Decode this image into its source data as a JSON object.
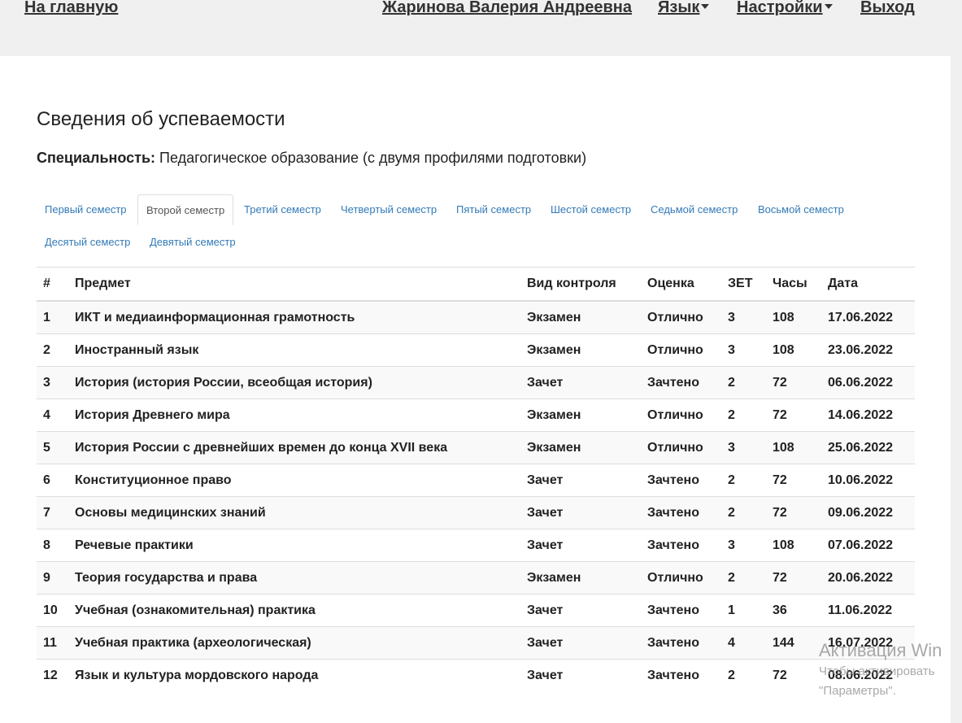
{
  "nav": {
    "home": "На главную",
    "user": "Жаринова Валерия Андреевна",
    "language": "Язык",
    "settings": "Настройки",
    "logout": "Выход"
  },
  "page": {
    "title": "Сведения об успеваемости",
    "specialty_label": "Специальность:",
    "specialty_value": " Педагогическое образование (с двумя профилями подготовки)"
  },
  "tabs": [
    {
      "label": "Первый семестр",
      "active": false
    },
    {
      "label": "Второй семестр",
      "active": true
    },
    {
      "label": "Третий семестр",
      "active": false
    },
    {
      "label": "Четвертый семестр",
      "active": false
    },
    {
      "label": "Пятый семестр",
      "active": false
    },
    {
      "label": "Шестой семестр",
      "active": false
    },
    {
      "label": "Седьмой семестр",
      "active": false
    },
    {
      "label": "Восьмой семестр",
      "active": false
    },
    {
      "label": "Десятый семестр",
      "active": false
    },
    {
      "label": "Девятый семестр",
      "active": false
    }
  ],
  "table": {
    "headers": [
      "#",
      "Предмет",
      "Вид контроля",
      "Оценка",
      "ЗЕТ",
      "Часы",
      "Дата"
    ],
    "rows": [
      [
        "1",
        "ИКТ и медиаинформационная грамотность",
        "Экзамен",
        "Отлично",
        "3",
        "108",
        "17.06.2022"
      ],
      [
        "2",
        "Иностранный язык",
        "Экзамен",
        "Отлично",
        "3",
        "108",
        "23.06.2022"
      ],
      [
        "3",
        "История (история России, всеобщая история)",
        "Зачет",
        "Зачтено",
        "2",
        "72",
        "06.06.2022"
      ],
      [
        "4",
        "История Древнего мира",
        "Экзамен",
        "Отлично",
        "2",
        "72",
        "14.06.2022"
      ],
      [
        "5",
        "История России с древнейших времен до конца XVII века",
        "Экзамен",
        "Отлично",
        "3",
        "108",
        "25.06.2022"
      ],
      [
        "6",
        "Конституционное право",
        "Зачет",
        "Зачтено",
        "2",
        "72",
        "10.06.2022"
      ],
      [
        "7",
        "Основы медицинских знаний",
        "Зачет",
        "Зачтено",
        "2",
        "72",
        "09.06.2022"
      ],
      [
        "8",
        "Речевые практики",
        "Зачет",
        "Зачтено",
        "3",
        "108",
        "07.06.2022"
      ],
      [
        "9",
        "Теория государства и права",
        "Экзамен",
        "Отлично",
        "2",
        "72",
        "20.06.2022"
      ],
      [
        "10",
        "Учебная (ознакомительная) практика",
        "Зачет",
        "Зачтено",
        "1",
        "36",
        "11.06.2022"
      ],
      [
        "11",
        "Учебная практика (археологическая)",
        "Зачет",
        "Зачтено",
        "4",
        "144",
        "16.07.2022"
      ],
      [
        "12",
        "Язык и культура мордовского народа",
        "Зачет",
        "Зачтено",
        "2",
        "72",
        "08.06.2022"
      ]
    ]
  },
  "watermark": {
    "title": "Активация Win",
    "line1": "Чтобы активировать",
    "line2": "\"Параметры\"."
  }
}
